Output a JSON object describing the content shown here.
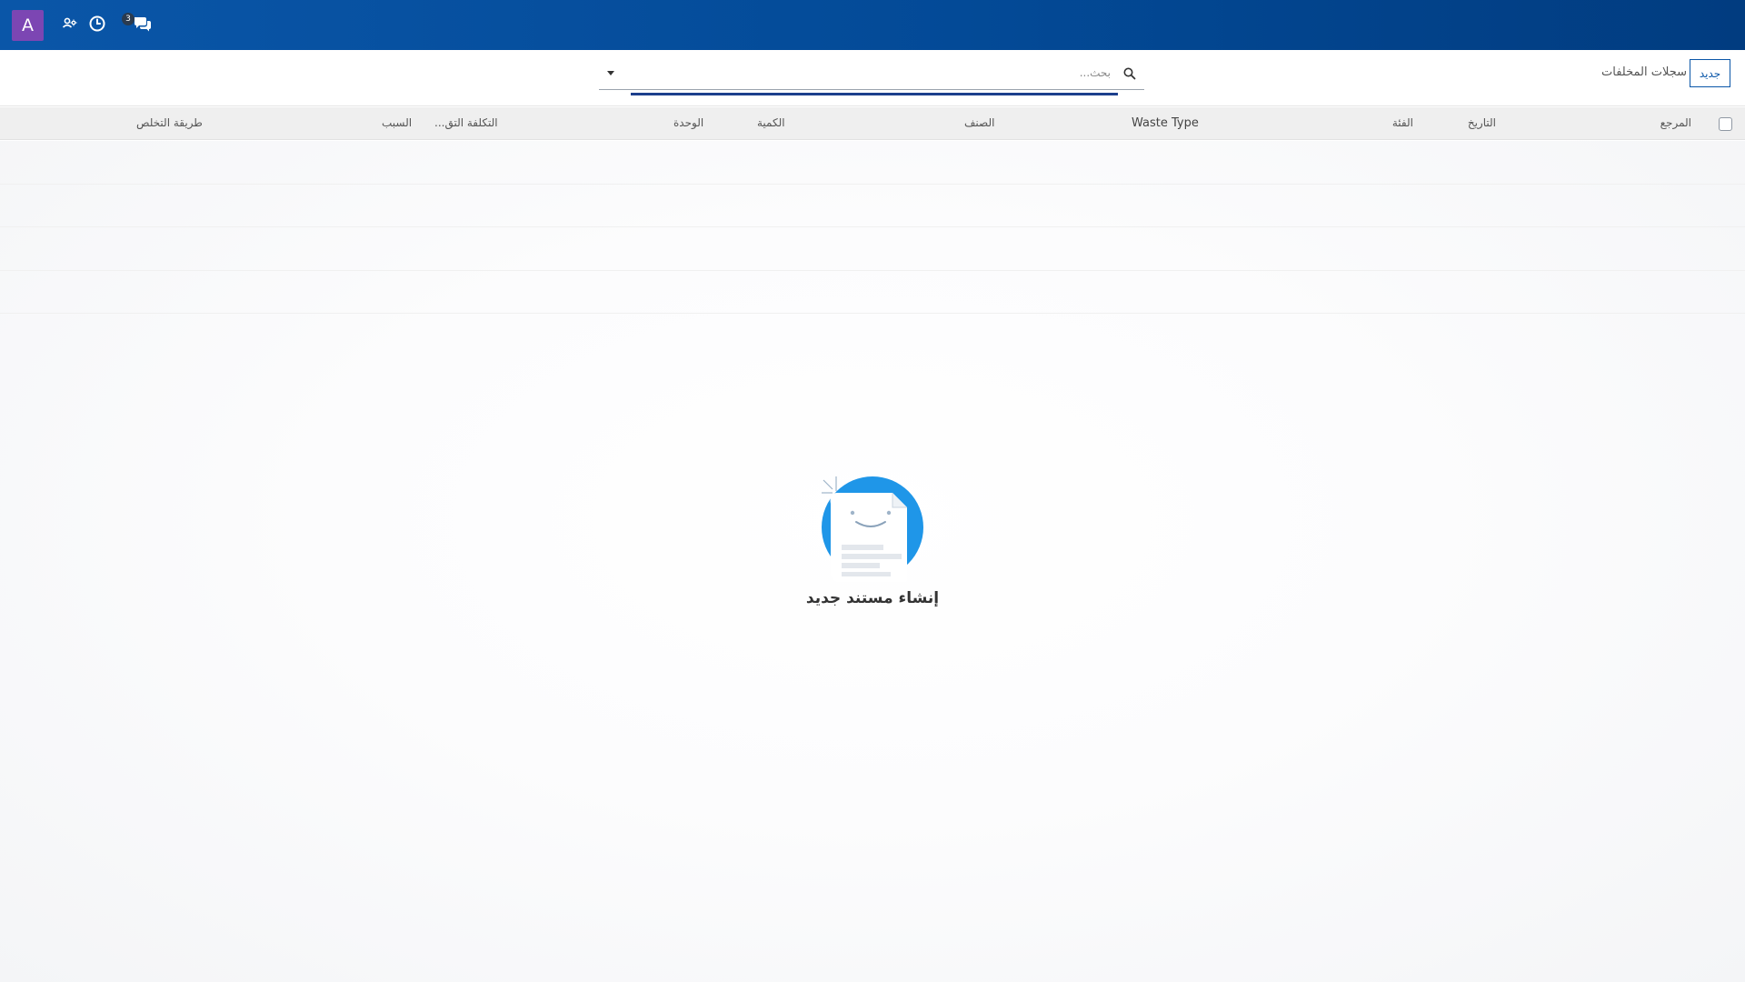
{
  "navbar": {
    "avatar_letter": "A",
    "messages_count": "3",
    "colors": {
      "gradient_start": "#0a56a8",
      "gradient_end": "#013c80",
      "avatar_bg": "#7c46b3"
    },
    "icons": [
      "avatar",
      "users-cog-icon",
      "clock-icon",
      "chat-icon"
    ]
  },
  "control_panel": {
    "new_button": "جديد",
    "breadcrumb": "سجلات المخلفات",
    "search_placeholder": "بحث..."
  },
  "table": {
    "columns": {
      "reference": "المرجع",
      "date": "التاريخ",
      "category": "الفئة",
      "waste_type": "Waste Type",
      "item": "الصنف",
      "quantity": "الكمية",
      "unit": "الوحدة",
      "cost": "التكلفة التق...",
      "reason": "السبب",
      "disposal": "طريقة التخلص"
    }
  },
  "empty_state": {
    "title": "إنشاء مستند جديد"
  }
}
